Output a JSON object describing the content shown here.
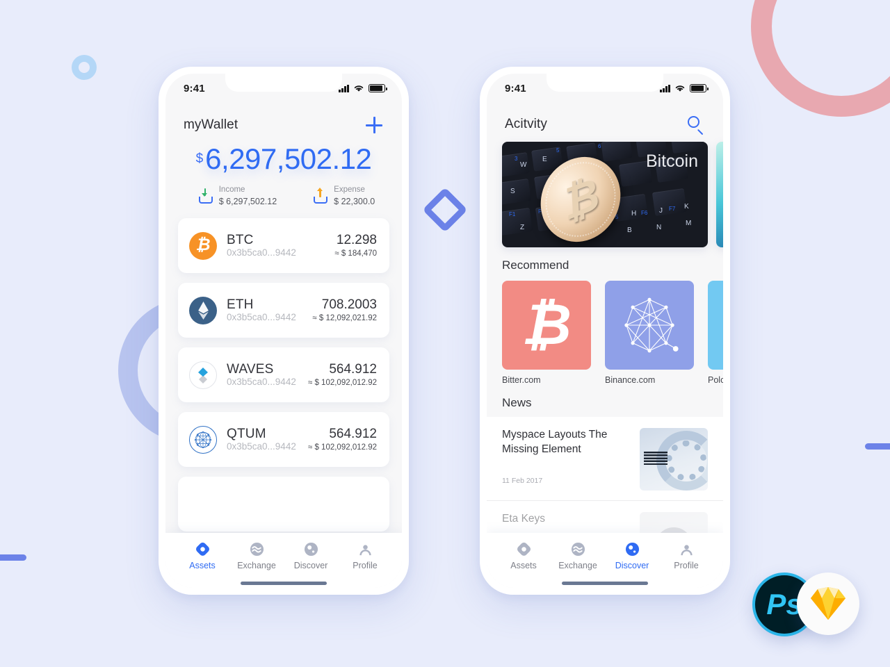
{
  "background": {
    "color": "#e8ecfb",
    "decorations": [
      {
        "name": "pink-ring",
        "color": "#e8a8b0"
      },
      {
        "name": "small-blue-ring",
        "color": "#b4d7f7"
      },
      {
        "name": "purple-arc",
        "color": "#b8c4ef"
      },
      {
        "name": "blue-bar-left",
        "color": "#6c82e8"
      },
      {
        "name": "blue-bar-right",
        "color": "#6c82e8"
      },
      {
        "name": "blue-diamond",
        "color": "#6c82e8"
      }
    ]
  },
  "accent": {
    "blue": "#2f6bf3",
    "orange": "#f79226",
    "green": "#33b36b",
    "amber": "#f5a623"
  },
  "phone1": {
    "status": {
      "time": "9:41",
      "signal_icon": "signal-bars-icon",
      "wifi_icon": "wifi-icon",
      "battery_icon": "battery-icon"
    },
    "header": {
      "title": "myWallet",
      "add_icon": "plus-icon"
    },
    "balance": {
      "currency": "$",
      "amount": "6,297,502.12"
    },
    "income": {
      "icon": "download-arrow-icon",
      "label": "Income",
      "value": "$ 6,297,502.12"
    },
    "expense": {
      "icon": "upload-arrow-icon",
      "label": "Expense",
      "value": "$ 22,300.0"
    },
    "assets": [
      {
        "icon": "bitcoin-coin-icon",
        "symbol": "BTC",
        "address": "0x3b5ca0...9442",
        "quantity": "12.298",
        "fiat": "≈ $ 184,470"
      },
      {
        "icon": "ethereum-coin-icon",
        "symbol": "ETH",
        "address": "0x3b5ca0...9442",
        "quantity": "708.2003",
        "fiat": "≈ $ 12,092,021.92"
      },
      {
        "icon": "waves-coin-icon",
        "symbol": "WAVES",
        "address": "0x3b5ca0...9442",
        "quantity": "564.912",
        "fiat": "≈ $ 102,092,012.92"
      },
      {
        "icon": "qtum-coin-icon",
        "symbol": "QTUM",
        "address": "0x3b5ca0...9442",
        "quantity": "564.912",
        "fiat": "≈ $ 102,092,012.92"
      }
    ],
    "tabs": [
      {
        "icon": "assets-diamond-icon",
        "label": "Assets",
        "active": true
      },
      {
        "icon": "exchange-waves-icon",
        "label": "Exchange",
        "active": false
      },
      {
        "icon": "discover-compass-icon",
        "label": "Discover",
        "active": false
      },
      {
        "icon": "profile-person-icon",
        "label": "Profile",
        "active": false
      }
    ]
  },
  "phone2": {
    "status": {
      "time": "9:41",
      "signal_icon": "signal-bars-icon",
      "wifi_icon": "wifi-icon",
      "battery_icon": "battery-icon"
    },
    "header": {
      "title": "Acitvity",
      "search_icon": "search-icon"
    },
    "banner": {
      "caption": "Bitcoin"
    },
    "recommend": {
      "title": "Recommend",
      "items": [
        {
          "icon": "bitcoin-glyph-icon",
          "label": "Bitter.com",
          "color": "#f28b84"
        },
        {
          "icon": "network-graph-icon",
          "label": "Binance.com",
          "color": "#8fa0e8"
        },
        {
          "icon": "poloniex-icon",
          "label": "Poloniex.com",
          "color": "#72c9f2"
        }
      ]
    },
    "news": {
      "title": "News",
      "items": [
        {
          "title": "Myspace Layouts The Missing Element",
          "date": "11 Feb 2017",
          "thumb": "ibm-server-image"
        },
        {
          "title": "Eta Keys",
          "date": "",
          "thumb": "avatar-image"
        }
      ]
    },
    "tabs": [
      {
        "icon": "assets-diamond-icon",
        "label": "Assets",
        "active": false
      },
      {
        "icon": "exchange-waves-icon",
        "label": "Exchange",
        "active": false
      },
      {
        "icon": "discover-compass-icon",
        "label": "Discover",
        "active": true
      },
      {
        "icon": "profile-person-icon",
        "label": "Profile",
        "active": false
      }
    ]
  },
  "badges": [
    {
      "name": "photoshop-badge",
      "label": "Ps"
    },
    {
      "name": "sketch-badge",
      "label": "Sketch"
    }
  ]
}
